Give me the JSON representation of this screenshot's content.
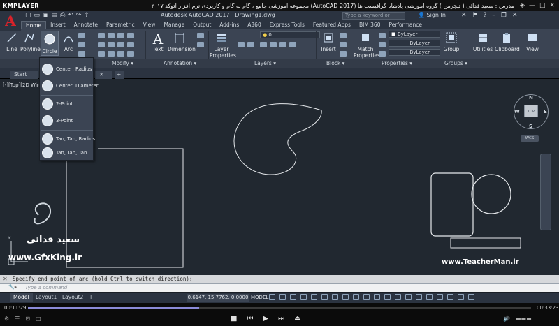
{
  "player": {
    "name": "KMPLAYER",
    "caption": "مجموعه آموزشی جامع ، گام به گام و کاربردی نرم افزار   اتوکد ۲۰۱۷ (AutoCAD 2017)   مدرس : سعید فدائی ( تیچرمن ) گروه آموزشی پادشاه گرافیست ها",
    "time_elapsed": "00:11:29",
    "time_total": "00:33:23",
    "progress": 0.34
  },
  "app": {
    "title": "Autodesk AutoCAD 2017",
    "drawing": "Drawing1.dwg",
    "search_placeholder": "Type a keyword or phrase",
    "sign_in": "Sign In",
    "logo_letter": "A"
  },
  "ribbon_tabs": [
    "Home",
    "Insert",
    "Annotate",
    "Parametric",
    "View",
    "Manage",
    "Output",
    "Add-ins",
    "A360",
    "Express Tools",
    "Featured Apps",
    "BIM 360",
    "Performance"
  ],
  "ribbon": {
    "draw": {
      "line": "Line",
      "polyline": "Polyline",
      "circle": "Circle",
      "arc": "Arc"
    },
    "modify_label": "Modify",
    "text": "Text",
    "dimension": "Dimension",
    "annotation_label": "Annotation",
    "layer_properties": "Layer Properties",
    "layer_value": "0",
    "layers_label": "Layers",
    "insert": "Insert",
    "block_label": "Block",
    "match_properties": "Match Properties",
    "bylayer_1": "ByLayer",
    "bylayer_2": "ByLayer",
    "bylayer_3": "ByLayer",
    "properties_label": "Properties",
    "group": "Group",
    "groups_label": "Groups",
    "utilities": "Utilities",
    "clipboard": "Clipboard",
    "view": "View"
  },
  "file_tabs": {
    "start": "Start",
    "plus": "+"
  },
  "viewport_label": "[-][Top][2D Wireframe]",
  "circle_menu": [
    "Center, Radius",
    "Center, Diameter",
    "2-Point",
    "3-Point",
    "Tan, Tan, Radius",
    "Tan, Tan, Tan"
  ],
  "viewcube": {
    "top": "TOP",
    "n": "N",
    "s": "S",
    "e": "E",
    "w": "W",
    "wcs": "WCS"
  },
  "watermarks": {
    "signature": "سعید فدائی",
    "site_left": "www.GfxKing.ir",
    "site_right": "www.TeacherMan.ir"
  },
  "command": {
    "history": "Specify end point of arc (hold Ctrl to switch direction):",
    "placeholder": "Type a command"
  },
  "layout_tabs": [
    "Model",
    "Layout1",
    "Layout2"
  ],
  "status": {
    "coords": "0.6147, 15.7762, 0.0000",
    "model": "MODEL"
  },
  "colors": {
    "canvas": "#212830",
    "ribbon": "#3b4453",
    "acad_red": "#d8222a"
  }
}
